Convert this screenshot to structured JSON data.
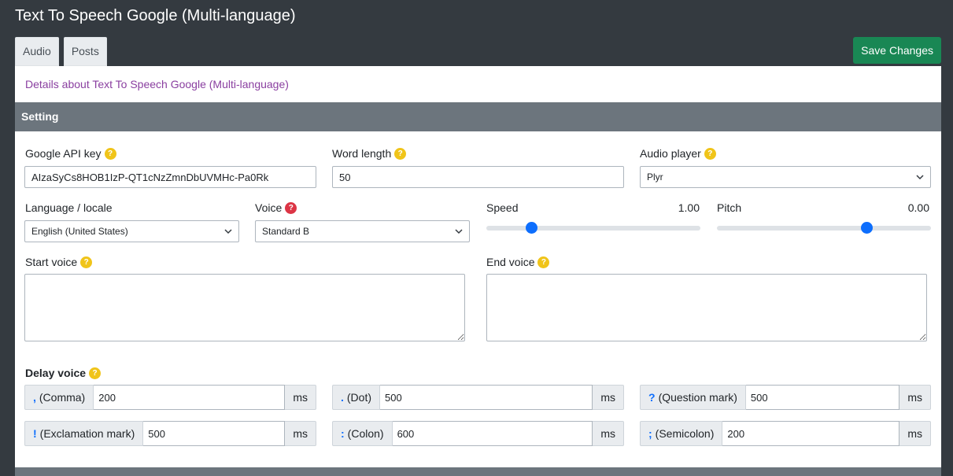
{
  "header": {
    "title": "Text To Speech Google (Multi-language)",
    "tabs": [
      {
        "label": "Audio"
      },
      {
        "label": "Posts"
      }
    ],
    "save_label": "Save Changes"
  },
  "details_link": "Details about Text To Speech Google (Multi-language)",
  "section_title": "Setting",
  "fields": {
    "api_key": {
      "label": "Google API key",
      "value": "AIzaSyCs8HOB1IzP-QT1cNzZmnDbUVMHc-Pa0Rk",
      "help": "?"
    },
    "word_length": {
      "label": "Word length",
      "value": "50",
      "help": "?"
    },
    "audio_player": {
      "label": "Audio player",
      "value": "Plyr",
      "help": "?"
    },
    "language": {
      "label": "Language / locale",
      "value": "English (United States)"
    },
    "voice": {
      "label": "Voice",
      "value": "Standard B",
      "help": "?"
    },
    "speed": {
      "label": "Speed",
      "value": "1.00",
      "fraction": 0.21
    },
    "pitch": {
      "label": "Pitch",
      "value": "0.00",
      "fraction": 0.7
    },
    "start_voice": {
      "label": "Start voice",
      "value": "",
      "help": "?"
    },
    "end_voice": {
      "label": "End voice",
      "value": "",
      "help": "?"
    }
  },
  "delay": {
    "label": "Delay voice",
    "help": "?",
    "unit": "ms",
    "items": [
      {
        "symbol": ",",
        "name": "(Comma)",
        "value": "200"
      },
      {
        "symbol": ".",
        "name": "(Dot)",
        "value": "500"
      },
      {
        "symbol": "?",
        "name": "(Question mark)",
        "value": "500"
      },
      {
        "symbol": "!",
        "name": "(Exclamation mark)",
        "value": "500"
      },
      {
        "symbol": ":",
        "name": "(Colon)",
        "value": "600"
      },
      {
        "symbol": ";",
        "name": "(Semicolon)",
        "value": "200"
      }
    ]
  }
}
